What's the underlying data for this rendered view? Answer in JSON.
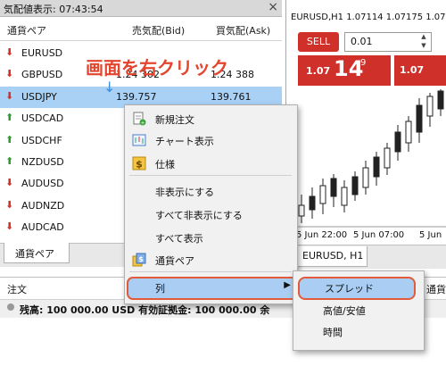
{
  "market_watch": {
    "header": "気配値表示: 07:43:54",
    "col_symbol": "通貨ペア",
    "col_bid": "売気配(Bid)",
    "col_ask": "買気配(Ask)",
    "rows": [
      {
        "symbol": "EURUSD",
        "dir": "down",
        "bid": "",
        "ask": ""
      },
      {
        "symbol": "GBPUSD",
        "dir": "down",
        "bid": "1.24 302",
        "ask": "1.24 388"
      },
      {
        "symbol": "USDJPY",
        "dir": "down",
        "bid": "139.757",
        "ask": "139.761"
      },
      {
        "symbol": "USDCAD",
        "dir": "up",
        "bid": "",
        "ask": ""
      },
      {
        "symbol": "USDCHF",
        "dir": "up",
        "bid": "",
        "ask": ""
      },
      {
        "symbol": "NZDUSD",
        "dir": "up",
        "bid": "",
        "ask": ""
      },
      {
        "symbol": "AUDUSD",
        "dir": "down",
        "bid": "",
        "ask": ""
      },
      {
        "symbol": "AUDNZD",
        "dir": "down",
        "bid": "",
        "ask": ""
      },
      {
        "symbol": "AUDCAD",
        "dir": "down",
        "bid": "",
        "ask": ""
      }
    ],
    "tab": "通貨ペア",
    "close_glyph": "×",
    "arrow_up": "⬆",
    "arrow_down": "⬇"
  },
  "chart": {
    "title": "EURUSD,H1  1.07114  1.07175  1.07",
    "sell_label": "SELL",
    "lot_value": "0.01",
    "price_prefix": "1.07",
    "price_big": "14",
    "price_sup": "9",
    "price2_prefix": "1.07",
    "times": [
      "5 Jun 22:00",
      "5 Jun 07:00",
      "5 Jun"
    ],
    "tab": "EURUSD, H1"
  },
  "annotation": {
    "text": "画面を右クリック",
    "arrow": "↓",
    "color": "#e4452e"
  },
  "context_menu": {
    "items": [
      {
        "label": "新規注文",
        "icon": "new-order-icon"
      },
      {
        "label": "チャート表示",
        "icon": "chart-icon"
      },
      {
        "label": "仕様",
        "icon": "dollar-icon"
      },
      {
        "label": "非表示にする"
      },
      {
        "label": "すべて非表示にする"
      },
      {
        "label": "すべて表示"
      },
      {
        "label": "通貨ペア",
        "icon": "symbols-icon"
      },
      {
        "label": "列",
        "submenu": true
      }
    ],
    "submenu_arrow": "▶"
  },
  "submenu": {
    "items": [
      "スプレッド",
      "高値/安値",
      "時間"
    ]
  },
  "terminal": {
    "col_order": "注文",
    "col_right": "通貨",
    "balance_text": "残高: 100 000.00 USD  有効証拠金: 100 000.00  余"
  },
  "colors": {
    "up": "#2e9a2e",
    "down": "#d0302a",
    "highlight": "#a9cdf3",
    "outline": "#e25a3a"
  }
}
